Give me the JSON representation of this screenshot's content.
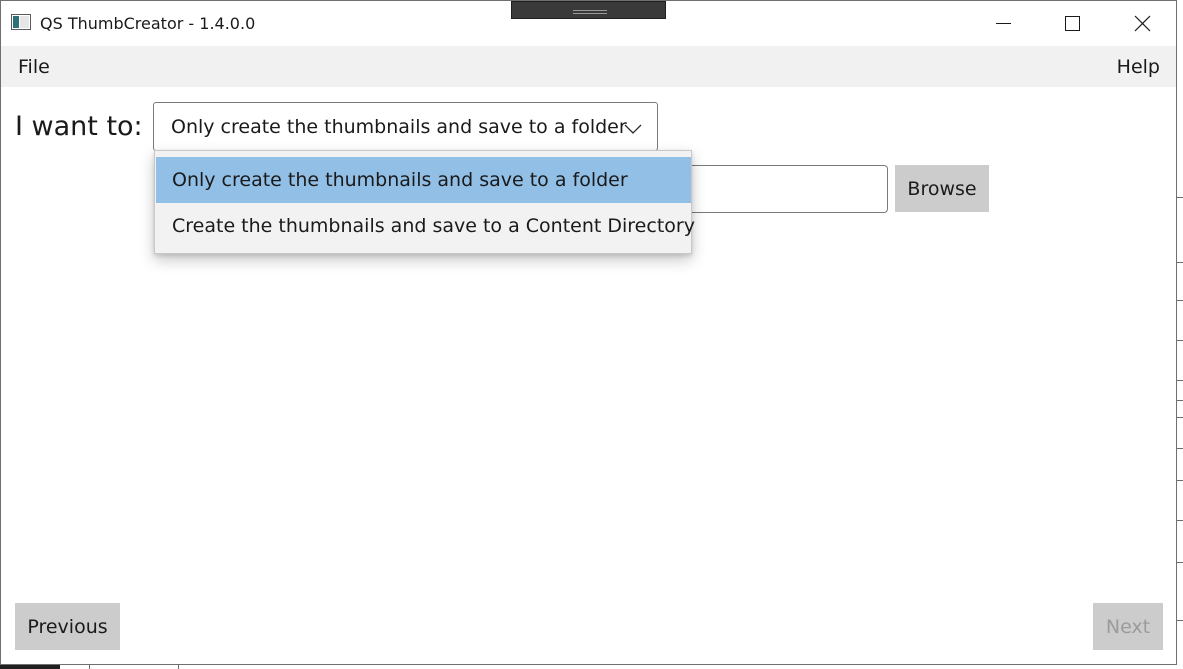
{
  "window": {
    "title": "QS ThumbCreator - 1.4.0.0",
    "icon": "app-window-icon",
    "controls": [
      "minimize-icon",
      "maximize-icon",
      "close-icon"
    ]
  },
  "menu": {
    "file": "File",
    "help": "Help"
  },
  "main": {
    "want_label": "I want to:",
    "selected_option": "Only create the thumbnails and save to a folder",
    "options": [
      "Only create the thumbnails and save to a folder",
      "Create the thumbnails and save to a Content Directory"
    ],
    "path_value": "",
    "browse_label": "Browse"
  },
  "footer": {
    "previous_label": "Previous",
    "next_label": "Next"
  },
  "colors": {
    "accent_selected": "#92bfe6",
    "button_bg": "#cccccc",
    "menubar_bg": "#f1f1f1",
    "disabled_text": "#9b9b9b"
  }
}
